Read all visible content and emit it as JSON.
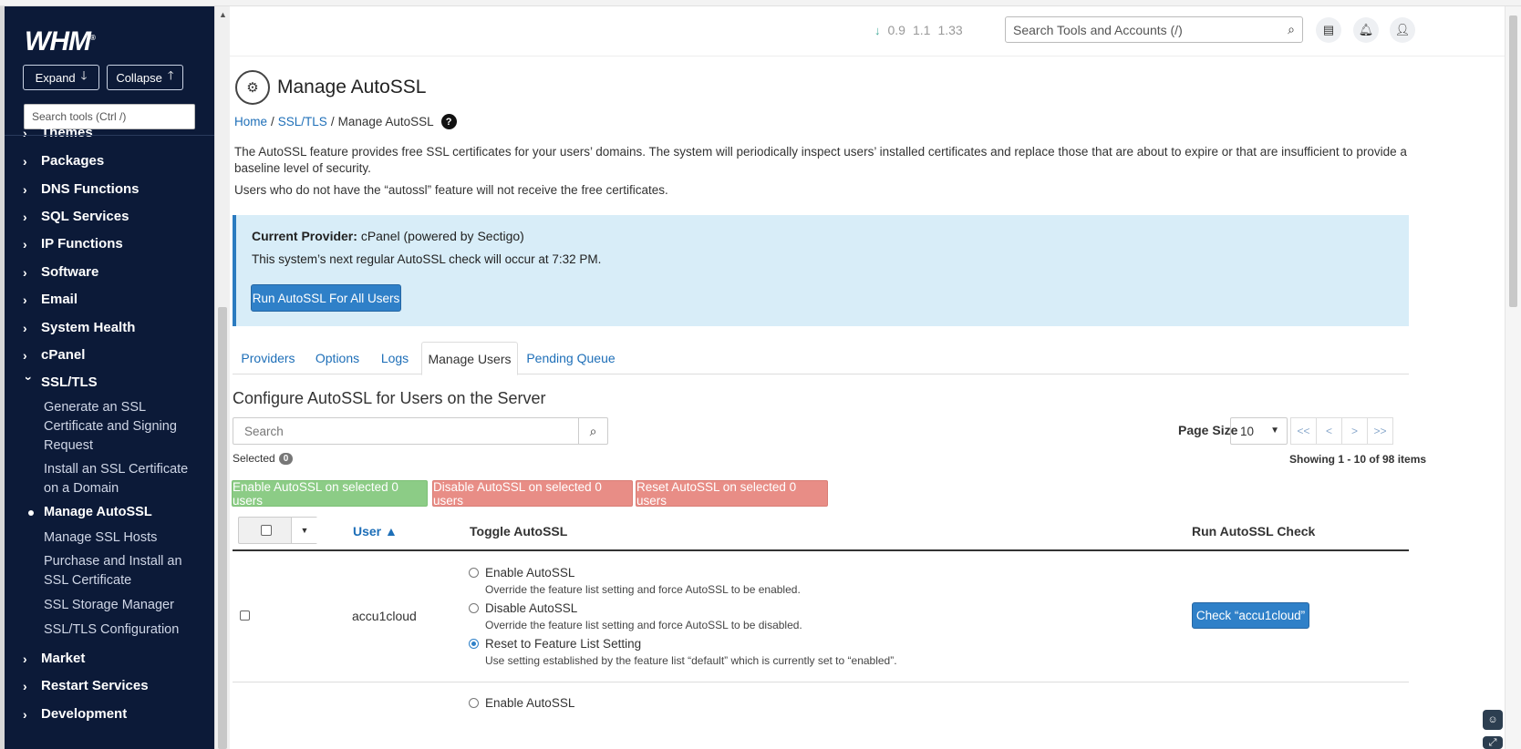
{
  "app": {
    "logo": "WHM",
    "logo_mark": "®"
  },
  "sidebar": {
    "expand_label": "Expand",
    "collapse_label": "Collapse",
    "search_placeholder": "Search tools (Ctrl /)",
    "items": [
      {
        "label": "Themes"
      },
      {
        "label": "Packages"
      },
      {
        "label": "DNS Functions"
      },
      {
        "label": "SQL Services"
      },
      {
        "label": "IP Functions"
      },
      {
        "label": "Software"
      },
      {
        "label": "Email"
      },
      {
        "label": "System Health"
      },
      {
        "label": "cPanel"
      },
      {
        "label": "SSL/TLS"
      },
      {
        "label": "Market"
      },
      {
        "label": "Restart Services"
      },
      {
        "label": "Development"
      }
    ],
    "ssl_sub": [
      {
        "label": "Generate an SSL Certificate and Signing Request"
      },
      {
        "label": "Install an SSL Certificate on a Domain"
      },
      {
        "label": "Manage AutoSSL"
      },
      {
        "label": "Manage SSL Hosts"
      },
      {
        "label": "Purchase and Install an SSL Certificate"
      },
      {
        "label": "SSL Storage Manager"
      },
      {
        "label": "SSL/TLS Configuration"
      }
    ]
  },
  "header": {
    "load_values": [
      "0.9",
      "1.1",
      "1.33"
    ],
    "search_placeholder": "Search Tools and Accounts (/)"
  },
  "page": {
    "title": "Manage AutoSSL",
    "breadcrumb": {
      "home": "Home",
      "ssl": "SSL/TLS",
      "current": "Manage AutoSSL"
    },
    "intro": "The AutoSSL feature provides free SSL certificates for your users’ domains. The system will periodically inspect users’ installed certificates and replace those that are about to expire or that are insufficient to provide a baseline level of security.",
    "intro2": "Users who do not have the “autossl” feature will not receive the free certificates.",
    "provider_label": "Current Provider:",
    "provider_value": "cPanel (powered by Sectigo)",
    "next_check": "This system’s next regular AutoSSL check will occur at 7:32 PM.",
    "run_all_label": "Run AutoSSL For All Users"
  },
  "tabs": [
    "Providers",
    "Options",
    "Logs",
    "Manage Users",
    "Pending Queue"
  ],
  "users_section": {
    "title": "Configure AutoSSL for Users on the Server",
    "search_placeholder": "Search",
    "page_size_label": "Page Size",
    "page_size_value": "10",
    "pager": [
      "<<",
      "<",
      ">",
      ">>"
    ],
    "selected_label": "Selected",
    "selected_count": "0",
    "showing": "Showing 1 - 10 of 98 items",
    "enable_selected": "Enable AutoSSL on selected 0 users",
    "disable_selected": "Disable AutoSSL on selected 0 users",
    "reset_selected": "Reset AutoSSL on selected 0 users",
    "columns": {
      "user": "User ▲",
      "toggle": "Toggle AutoSSL",
      "run": "Run AutoSSL Check"
    },
    "rows": [
      {
        "user": "accu1cloud",
        "options": [
          {
            "label": "Enable AutoSSL",
            "desc": "Override the feature list setting and force AutoSSL to be enabled."
          },
          {
            "label": "Disable AutoSSL",
            "desc": "Override the feature list setting and force AutoSSL to be disabled."
          },
          {
            "label": "Reset to Feature List Setting",
            "desc": "Use setting established by the feature list “default” which is currently set to “enabled”."
          }
        ],
        "check_label": "Check “accu1cloud”"
      }
    ],
    "next_row_first_option": "Enable AutoSSL"
  }
}
